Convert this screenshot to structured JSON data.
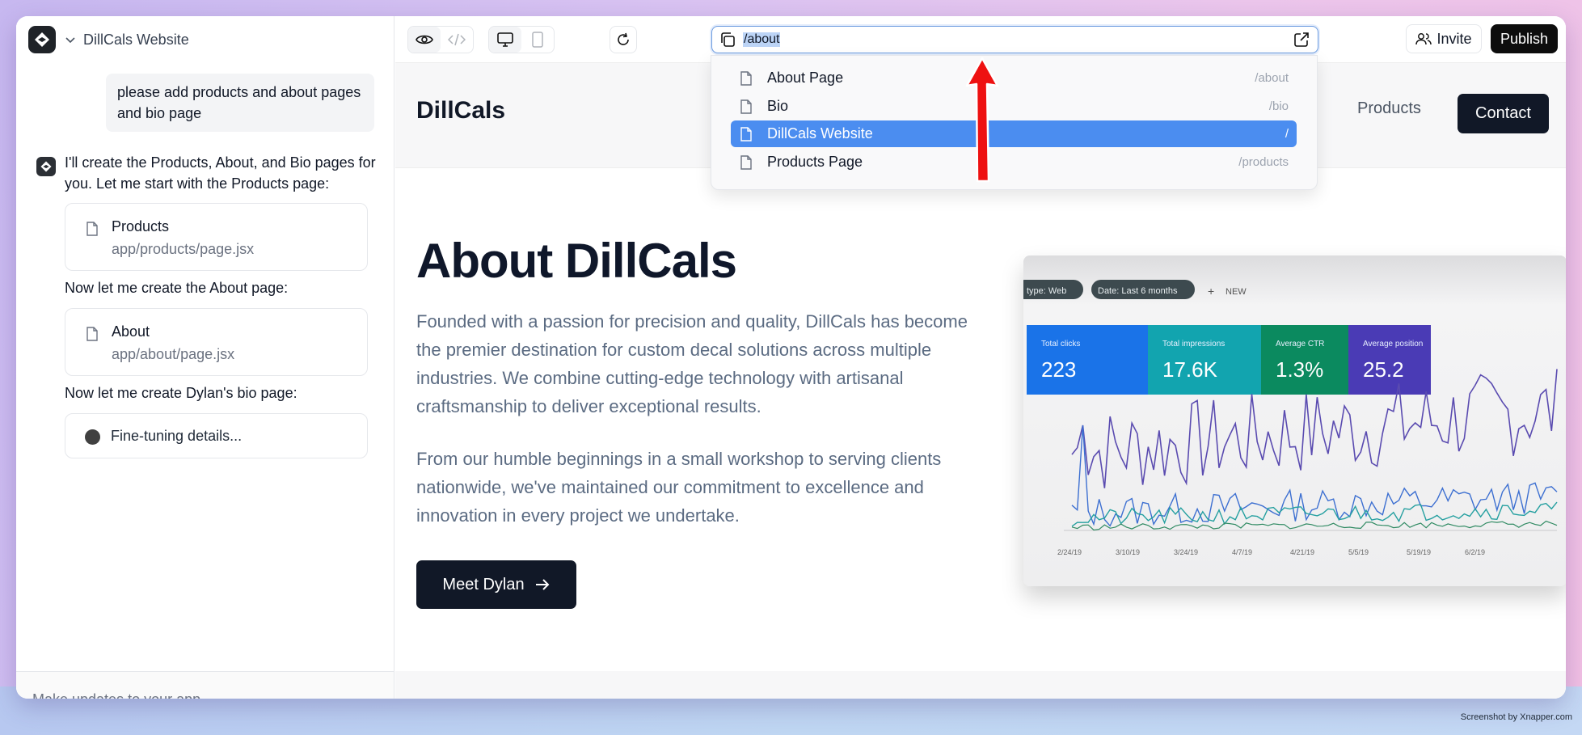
{
  "app": {
    "title": "DillCals Website"
  },
  "chat": {
    "user_message": "please add products and about pages and bio page",
    "ai_intro": "I'll create the Products, About, and Bio pages for you. Let me start with the Products page:",
    "files": [
      {
        "name": "Products",
        "path": "app/products/page.jsx"
      },
      {
        "name": "About",
        "path": "app/about/page.jsx"
      }
    ],
    "line_about": "Now let me create the About page:",
    "line_bio": "Now let me create Dylan's bio page:",
    "progress_text": "Fine-tuning details...",
    "input_placeholder": "Make updates to your app"
  },
  "toolbar": {
    "url_value": "/about",
    "invite_label": "Invite",
    "publish_label": "Publish"
  },
  "dropdown": {
    "items": [
      {
        "label": "About Page",
        "path": "/about",
        "selected": false
      },
      {
        "label": "Bio",
        "path": "/bio",
        "selected": false
      },
      {
        "label": "DillCals Website",
        "path": "/",
        "selected": true
      },
      {
        "label": "Products Page",
        "path": "/products",
        "selected": false
      }
    ]
  },
  "site": {
    "brand": "DillCals",
    "nav_products": "Products",
    "nav_contact": "Contact",
    "heading": "About DillCals",
    "paragraph1": "Founded with a passion for precision and quality, DillCals has become the premier destination for custom decal solutions across multiple industries. We combine cutting-edge technology with artisanal craftsmanship to deliver exceptional results.",
    "paragraph2": "From our humble beginnings in a small workshop to serving clients nationwide, we've maintained our commitment to excellence and innovation in every project we undertake.",
    "cta_label": "Meet Dylan"
  },
  "hero_image": {
    "chips": [
      "type: Web",
      "Date: Last 6 months"
    ],
    "new_label": "NEW",
    "metrics": [
      {
        "label": "Total clicks",
        "value": "223",
        "color": "#1a73e8"
      },
      {
        "label": "Total impressions",
        "value": "17.6K",
        "color": "#12a4af"
      },
      {
        "label": "Average CTR",
        "value": "1.3%",
        "color": "#0b8a5f"
      },
      {
        "label": "Average position",
        "value": "25.2",
        "color": "#4a3bb5"
      }
    ],
    "dates": [
      "2/24/19",
      "3/10/19",
      "3/24/19",
      "4/7/19",
      "4/21/19",
      "5/5/19",
      "5/19/19",
      "6/2/19"
    ]
  },
  "credit": "Screenshot by Xnapper.com"
}
